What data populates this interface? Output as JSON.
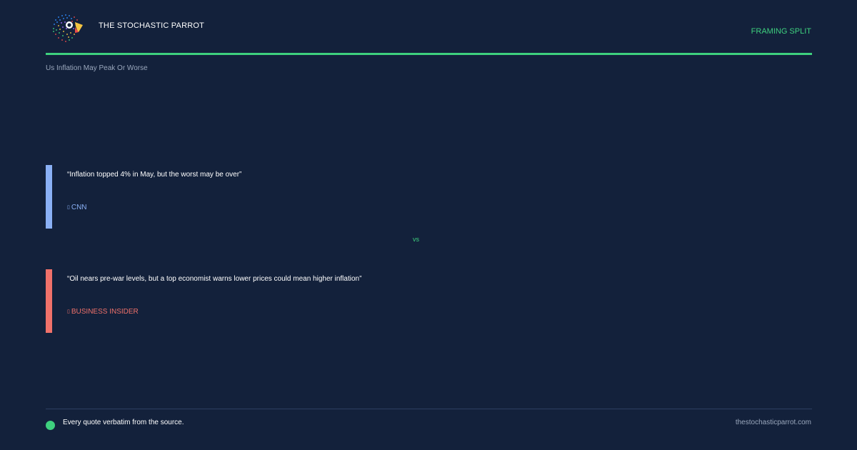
{
  "header": {
    "brand": "THE STOCHASTIC PARROT",
    "tag": "FRAMING SPLIT",
    "logo_icon": "parrot-logo-icon",
    "accent_color": "#3ed07e"
  },
  "topic": "Us Inflation May Peak Or Worse",
  "quotes": [
    {
      "text": "“Inflation topped 4% in May, but the worst may be over”",
      "source": "CNN",
      "source_glyph": "▯",
      "color": "#8ab0f5"
    },
    {
      "text": "“Oil nears pre-war levels, but a top economist warns lower prices could mean higher inflation”",
      "source": "BUSINESS INSIDER",
      "source_glyph": "▯",
      "color": "#f0716a"
    }
  ],
  "separator": "vs",
  "footer": {
    "note": "Every quote verbatim from the source.",
    "site": "thestochasticparrot.com"
  }
}
